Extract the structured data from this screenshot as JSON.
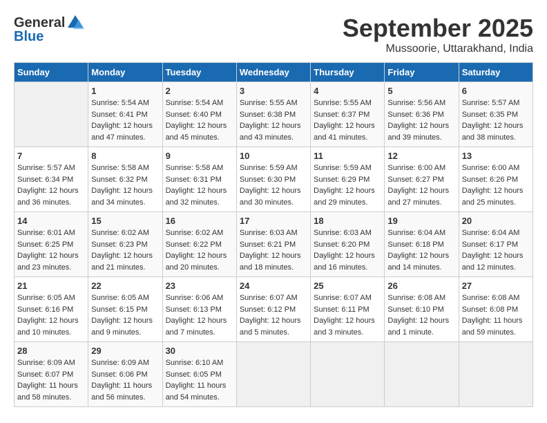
{
  "header": {
    "logo_general": "General",
    "logo_blue": "Blue",
    "month": "September 2025",
    "location": "Mussoorie, Uttarakhand, India"
  },
  "weekdays": [
    "Sunday",
    "Monday",
    "Tuesday",
    "Wednesday",
    "Thursday",
    "Friday",
    "Saturday"
  ],
  "weeks": [
    [
      {
        "day": "",
        "sunrise": "",
        "sunset": "",
        "daylight": ""
      },
      {
        "day": "1",
        "sunrise": "Sunrise: 5:54 AM",
        "sunset": "Sunset: 6:41 PM",
        "daylight": "Daylight: 12 hours and 47 minutes."
      },
      {
        "day": "2",
        "sunrise": "Sunrise: 5:54 AM",
        "sunset": "Sunset: 6:40 PM",
        "daylight": "Daylight: 12 hours and 45 minutes."
      },
      {
        "day": "3",
        "sunrise": "Sunrise: 5:55 AM",
        "sunset": "Sunset: 6:38 PM",
        "daylight": "Daylight: 12 hours and 43 minutes."
      },
      {
        "day": "4",
        "sunrise": "Sunrise: 5:55 AM",
        "sunset": "Sunset: 6:37 PM",
        "daylight": "Daylight: 12 hours and 41 minutes."
      },
      {
        "day": "5",
        "sunrise": "Sunrise: 5:56 AM",
        "sunset": "Sunset: 6:36 PM",
        "daylight": "Daylight: 12 hours and 39 minutes."
      },
      {
        "day": "6",
        "sunrise": "Sunrise: 5:57 AM",
        "sunset": "Sunset: 6:35 PM",
        "daylight": "Daylight: 12 hours and 38 minutes."
      }
    ],
    [
      {
        "day": "7",
        "sunrise": "Sunrise: 5:57 AM",
        "sunset": "Sunset: 6:34 PM",
        "daylight": "Daylight: 12 hours and 36 minutes."
      },
      {
        "day": "8",
        "sunrise": "Sunrise: 5:58 AM",
        "sunset": "Sunset: 6:32 PM",
        "daylight": "Daylight: 12 hours and 34 minutes."
      },
      {
        "day": "9",
        "sunrise": "Sunrise: 5:58 AM",
        "sunset": "Sunset: 6:31 PM",
        "daylight": "Daylight: 12 hours and 32 minutes."
      },
      {
        "day": "10",
        "sunrise": "Sunrise: 5:59 AM",
        "sunset": "Sunset: 6:30 PM",
        "daylight": "Daylight: 12 hours and 30 minutes."
      },
      {
        "day": "11",
        "sunrise": "Sunrise: 5:59 AM",
        "sunset": "Sunset: 6:29 PM",
        "daylight": "Daylight: 12 hours and 29 minutes."
      },
      {
        "day": "12",
        "sunrise": "Sunrise: 6:00 AM",
        "sunset": "Sunset: 6:27 PM",
        "daylight": "Daylight: 12 hours and 27 minutes."
      },
      {
        "day": "13",
        "sunrise": "Sunrise: 6:00 AM",
        "sunset": "Sunset: 6:26 PM",
        "daylight": "Daylight: 12 hours and 25 minutes."
      }
    ],
    [
      {
        "day": "14",
        "sunrise": "Sunrise: 6:01 AM",
        "sunset": "Sunset: 6:25 PM",
        "daylight": "Daylight: 12 hours and 23 minutes."
      },
      {
        "day": "15",
        "sunrise": "Sunrise: 6:02 AM",
        "sunset": "Sunset: 6:23 PM",
        "daylight": "Daylight: 12 hours and 21 minutes."
      },
      {
        "day": "16",
        "sunrise": "Sunrise: 6:02 AM",
        "sunset": "Sunset: 6:22 PM",
        "daylight": "Daylight: 12 hours and 20 minutes."
      },
      {
        "day": "17",
        "sunrise": "Sunrise: 6:03 AM",
        "sunset": "Sunset: 6:21 PM",
        "daylight": "Daylight: 12 hours and 18 minutes."
      },
      {
        "day": "18",
        "sunrise": "Sunrise: 6:03 AM",
        "sunset": "Sunset: 6:20 PM",
        "daylight": "Daylight: 12 hours and 16 minutes."
      },
      {
        "day": "19",
        "sunrise": "Sunrise: 6:04 AM",
        "sunset": "Sunset: 6:18 PM",
        "daylight": "Daylight: 12 hours and 14 minutes."
      },
      {
        "day": "20",
        "sunrise": "Sunrise: 6:04 AM",
        "sunset": "Sunset: 6:17 PM",
        "daylight": "Daylight: 12 hours and 12 minutes."
      }
    ],
    [
      {
        "day": "21",
        "sunrise": "Sunrise: 6:05 AM",
        "sunset": "Sunset: 6:16 PM",
        "daylight": "Daylight: 12 hours and 10 minutes."
      },
      {
        "day": "22",
        "sunrise": "Sunrise: 6:05 AM",
        "sunset": "Sunset: 6:15 PM",
        "daylight": "Daylight: 12 hours and 9 minutes."
      },
      {
        "day": "23",
        "sunrise": "Sunrise: 6:06 AM",
        "sunset": "Sunset: 6:13 PM",
        "daylight": "Daylight: 12 hours and 7 minutes."
      },
      {
        "day": "24",
        "sunrise": "Sunrise: 6:07 AM",
        "sunset": "Sunset: 6:12 PM",
        "daylight": "Daylight: 12 hours and 5 minutes."
      },
      {
        "day": "25",
        "sunrise": "Sunrise: 6:07 AM",
        "sunset": "Sunset: 6:11 PM",
        "daylight": "Daylight: 12 hours and 3 minutes."
      },
      {
        "day": "26",
        "sunrise": "Sunrise: 6:08 AM",
        "sunset": "Sunset: 6:10 PM",
        "daylight": "Daylight: 12 hours and 1 minute."
      },
      {
        "day": "27",
        "sunrise": "Sunrise: 6:08 AM",
        "sunset": "Sunset: 6:08 PM",
        "daylight": "Daylight: 11 hours and 59 minutes."
      }
    ],
    [
      {
        "day": "28",
        "sunrise": "Sunrise: 6:09 AM",
        "sunset": "Sunset: 6:07 PM",
        "daylight": "Daylight: 11 hours and 58 minutes."
      },
      {
        "day": "29",
        "sunrise": "Sunrise: 6:09 AM",
        "sunset": "Sunset: 6:06 PM",
        "daylight": "Daylight: 11 hours and 56 minutes."
      },
      {
        "day": "30",
        "sunrise": "Sunrise: 6:10 AM",
        "sunset": "Sunset: 6:05 PM",
        "daylight": "Daylight: 11 hours and 54 minutes."
      },
      {
        "day": "",
        "sunrise": "",
        "sunset": "",
        "daylight": ""
      },
      {
        "day": "",
        "sunrise": "",
        "sunset": "",
        "daylight": ""
      },
      {
        "day": "",
        "sunrise": "",
        "sunset": "",
        "daylight": ""
      },
      {
        "day": "",
        "sunrise": "",
        "sunset": "",
        "daylight": ""
      }
    ]
  ]
}
